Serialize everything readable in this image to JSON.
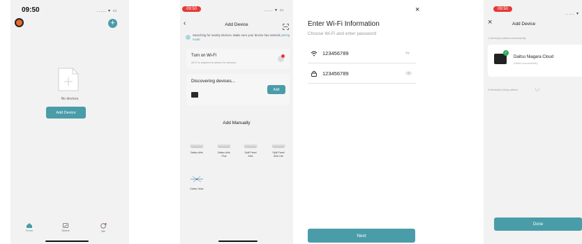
{
  "colors": {
    "accent": "#4a9ca9",
    "badge": "#e53935",
    "screen_bg": "#f2f2f2"
  },
  "screen1": {
    "time": "09:50",
    "status": "..... ▾ ▭",
    "empty_text": "No devices",
    "add_button": "Add Device",
    "tabs": [
      {
        "label": "Home",
        "icon": "home-icon"
      },
      {
        "label": "Scene",
        "icon": "scene-icon"
      },
      {
        "label": "Me",
        "icon": "profile-icon"
      }
    ]
  },
  "screen2": {
    "time": "09:50",
    "status": "..... ▾ ▭",
    "title": "Add Device",
    "searching_text": "Searching for nearby devices. Make sure your device has entered",
    "pairing_link": "pairing mode",
    "wifi_title": "Turn on Wi-Fi",
    "wifi_sub": "Wi-Fi is required to search for devices.",
    "discovering_title": "Discovering devices...",
    "add_label": "Add",
    "manual_title": "Add Manually",
    "devices": [
      {
        "name": "Daitsu Artic"
      },
      {
        "name": "Daitsu Artic Plus"
      },
      {
        "name": "Split Panel Artic"
      },
      {
        "name": "Split Panel Artic Lite"
      },
      {
        "name": "Daitsu Velar"
      }
    ]
  },
  "screen3": {
    "title": "Enter Wi-Fi Information",
    "subtitle": "Choose Wi-Fi and enter password",
    "ssid": "123456789",
    "password": "123456789",
    "next_label": "Next"
  },
  "screen4": {
    "time": "09:50",
    "status": "..... ▾",
    "title": "Add Device",
    "added_summary": "1 device(s) added successfully",
    "device_name": "Daitsu Niagara Cloud",
    "device_status": "Added successfully",
    "adding_summary": "0 device(s) being added",
    "done_label": "Done"
  }
}
